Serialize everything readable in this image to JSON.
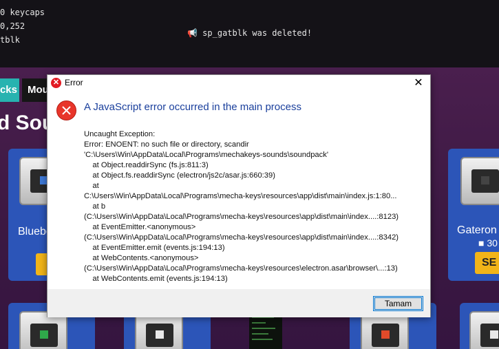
{
  "terminal": {
    "lines": [
      "0 keycaps",
      "0,252",
      "tblk"
    ],
    "message": "📢 sp_gatblk was deleted!"
  },
  "app": {
    "tabs": [
      {
        "label": "cks"
      },
      {
        "label": "Mou"
      }
    ],
    "title": "d Sou",
    "cards": [
      {
        "name": "Bluebe",
        "count": "",
        "set_label": "S"
      },
      {
        "name": "Gateron",
        "count": "30",
        "set_label": "SE"
      }
    ]
  },
  "dialog": {
    "window_title": "Error",
    "close_glyph": "✕",
    "heading": "A JavaScript error occurred in the main process",
    "lines": [
      "Uncaught Exception:",
      "Error: ENOENT: no such file or directory, scandir",
      "'C:\\Users\\Win\\AppData\\Local\\Programs\\mechakeys-sounds\\soundpack'",
      "    at Object.readdirSync (fs.js:811:3)",
      "    at Object.fs.readdirSync (electron/js2c/asar.js:660:39)",
      "    at",
      "C:\\Users\\Win\\AppData\\Local\\Programs\\mecha-keys\\resources\\app\\dist\\main\\index.js:1:80...",
      "    at b",
      "(C:\\Users\\Win\\AppData\\Local\\Programs\\mecha-keys\\resources\\app\\dist\\main\\index....:8123)",
      "    at EventEmitter.<anonymous>",
      "(C:\\Users\\Win\\AppData\\Local\\Programs\\mecha-keys\\resources\\app\\dist\\main\\index....:8342)",
      "    at EventEmitter.emit (events.js:194:13)",
      "    at WebContents.<anonymous>",
      "(C:\\Users\\Win\\AppData\\Local\\Programs\\mecha-keys\\resources\\electron.asar\\browser\\...:13)",
      "    at WebContents.emit (events.js:194:13)"
    ],
    "ok_label": "Tamam"
  },
  "colors": {
    "accent": "#27b3b0",
    "error_red": "#e8352a",
    "heading_blue": "#1a3f9c",
    "set_button": "#f2b418"
  },
  "icons": [
    "error-icon",
    "close-icon",
    "megaphone-icon",
    "keycap-icon"
  ]
}
